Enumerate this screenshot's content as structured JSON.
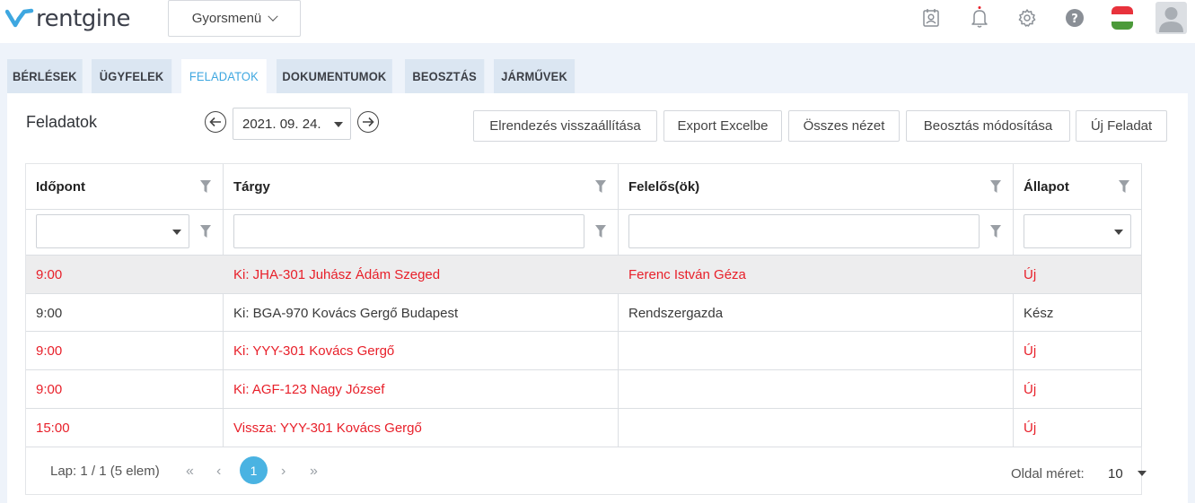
{
  "app": {
    "logo_text": "rentgine",
    "brand_color": "#3ea7e0"
  },
  "header": {
    "quick_menu_label": "Gyorsmenü",
    "icons": [
      "contacts-icon",
      "bell-icon",
      "gear-icon",
      "help-icon",
      "flag-hu-icon",
      "avatar-icon"
    ],
    "notification_dot_color": "#e8202a"
  },
  "tabs": [
    {
      "label": "BÉRLÉSEK",
      "active": false
    },
    {
      "label": "ÜGYFELEK",
      "active": false
    },
    {
      "label": "FELADATOK",
      "active": true
    },
    {
      "label": "DOKUMENTUMOK",
      "active": false
    },
    {
      "label": "BEOSZTÁS",
      "active": false
    },
    {
      "label": "JÁRMŰVEK",
      "active": false
    }
  ],
  "toolbar": {
    "title": "Feladatok",
    "date_value": "2021. 09. 24.",
    "reset_layout_label": "Elrendezés visszaállítása",
    "export_label": "Export Excelbe",
    "all_view_label": "Összes nézet",
    "schedule_label": "Beosztás módosítása",
    "new_task_label": "Új Feladat"
  },
  "grid": {
    "columns": [
      "Időpont",
      "Tárgy",
      "Felelős(ök)",
      "Állapot"
    ],
    "rows": [
      {
        "time": "9:00",
        "subject": "Ki: JHA-301 Juhász Ádám Szeged",
        "owner": "Ferenc István Géza",
        "status": "Új",
        "highlight": true,
        "color": "red"
      },
      {
        "time": "9:00",
        "subject": "Ki: BGA-970 Kovács Gergő Budapest",
        "owner": "Rendszergazda",
        "status": "Kész",
        "highlight": false,
        "color": "dark"
      },
      {
        "time": "9:00",
        "subject": "Ki: YYY-301 Kovács Gergő",
        "owner": "",
        "status": "Új",
        "highlight": false,
        "color": "red"
      },
      {
        "time": "9:00",
        "subject": "Ki: AGF-123 Nagy József",
        "owner": "",
        "status": "Új",
        "highlight": false,
        "color": "red"
      },
      {
        "time": "15:00",
        "subject": "Vissza: YYY-301 Kovács Gergő",
        "owner": "",
        "status": "Új",
        "highlight": false,
        "color": "red"
      }
    ],
    "status_colors": {
      "new": "#e8202a",
      "done": "#3a3a3a"
    }
  },
  "pager": {
    "info": "Lap: 1 / 1 (5 elem)",
    "current_page": "1",
    "page_size_label": "Oldal méret:",
    "page_size_value": "10"
  }
}
